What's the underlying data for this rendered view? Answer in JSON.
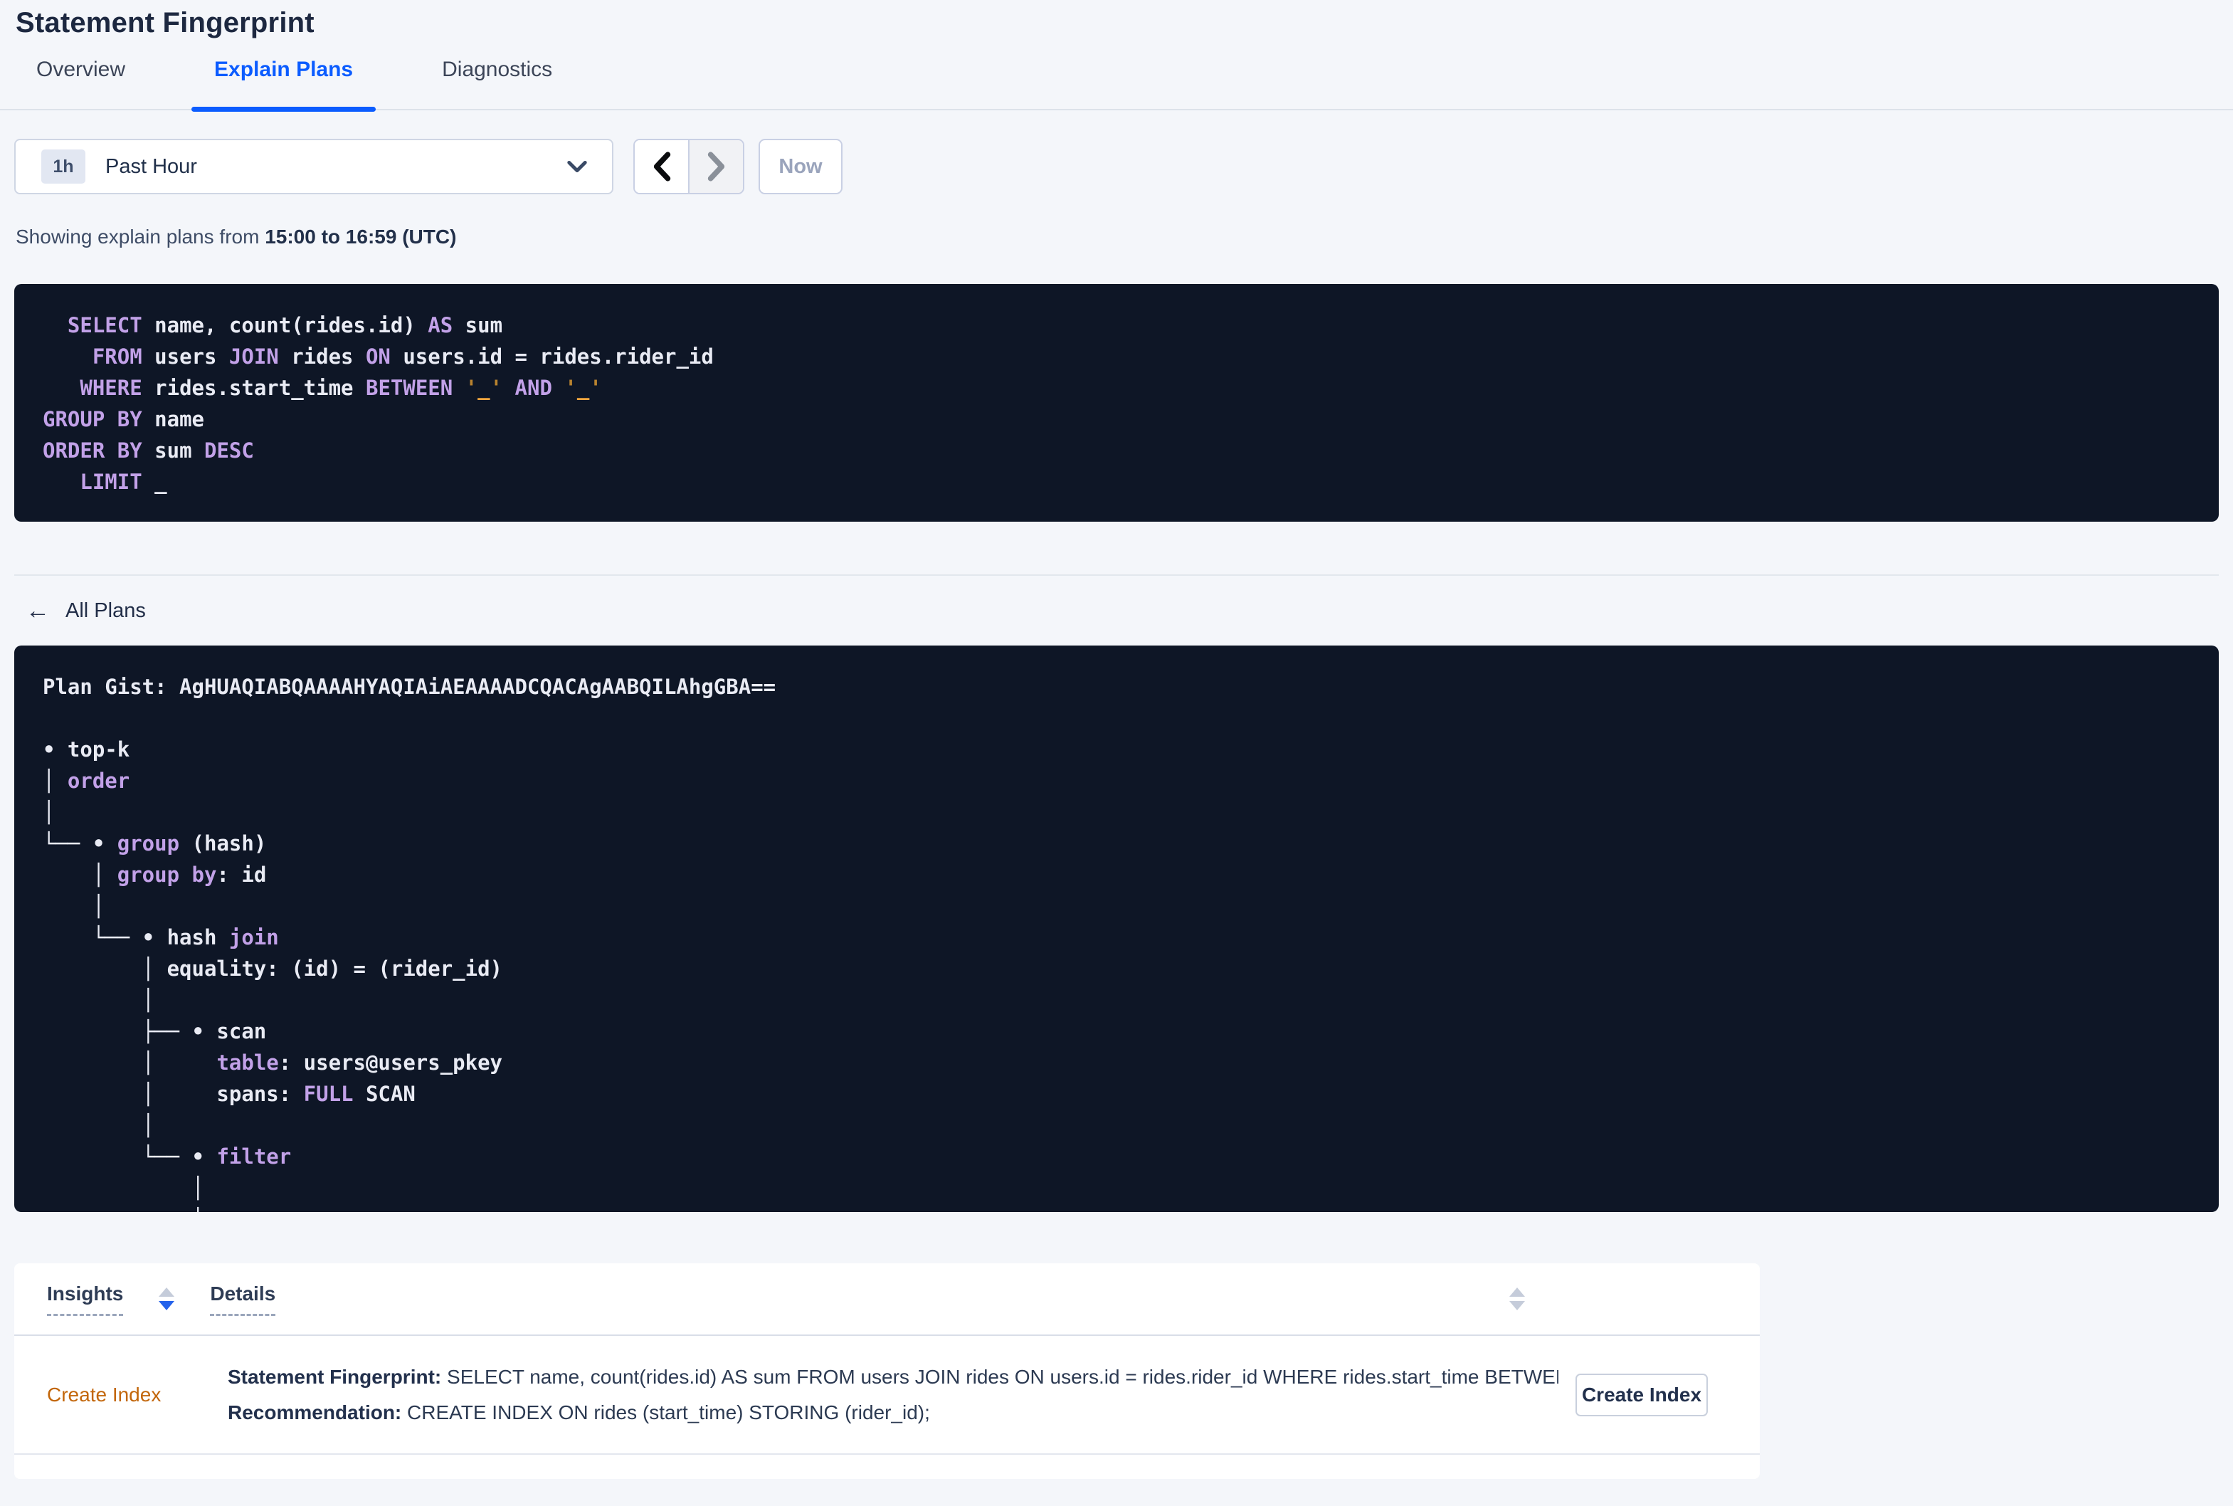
{
  "page": {
    "title": "Statement Fingerprint"
  },
  "tabs": [
    {
      "label": "Overview"
    },
    {
      "label": "Explain Plans"
    },
    {
      "label": "Diagnostics"
    }
  ],
  "toolbar": {
    "range_badge": "1h",
    "range_label": "Past Hour",
    "now_label": "Now"
  },
  "subtitle": {
    "prefix": "Showing explain plans from ",
    "bold": "15:00 to 16:59 (UTC)"
  },
  "back_link": {
    "label": "All Plans"
  },
  "colors": {
    "accent_blue": "#0B5CFF",
    "code_background": "#0E1626",
    "code_keyword": "#C2A1E8",
    "code_literal": "#F3A73F",
    "insight_orange": "#C2660A"
  },
  "sql": {
    "lines": [
      [
        [
          "t",
          "  "
        ],
        [
          "k",
          "SELECT"
        ],
        [
          "t",
          " name, count(rides.id) "
        ],
        [
          "k",
          "AS"
        ],
        [
          "t",
          " sum"
        ]
      ],
      [
        [
          "t",
          "    "
        ],
        [
          "k",
          "FROM"
        ],
        [
          "t",
          " users "
        ],
        [
          "k",
          "JOIN"
        ],
        [
          "t",
          " rides "
        ],
        [
          "k",
          "ON"
        ],
        [
          "t",
          " users.id = rides.rider_id"
        ]
      ],
      [
        [
          "t",
          "   "
        ],
        [
          "k",
          "WHERE"
        ],
        [
          "t",
          " rides.start_time "
        ],
        [
          "k",
          "BETWEEN"
        ],
        [
          "t",
          " "
        ],
        [
          "q",
          "'"
        ],
        [
          "l",
          "_"
        ],
        [
          "q",
          "'"
        ],
        [
          "t",
          " "
        ],
        [
          "k",
          "AND"
        ],
        [
          "t",
          " "
        ],
        [
          "q",
          "'"
        ],
        [
          "l",
          "_"
        ],
        [
          "q",
          "'"
        ]
      ],
      [
        [
          "k",
          "GROUP BY"
        ],
        [
          "t",
          " name"
        ]
      ],
      [
        [
          "k",
          "ORDER BY"
        ],
        [
          "t",
          " sum "
        ],
        [
          "k",
          "DESC"
        ]
      ],
      [
        [
          "t",
          "   "
        ],
        [
          "k",
          "LIMIT"
        ],
        [
          "t",
          " _"
        ]
      ]
    ]
  },
  "plan": {
    "lines": [
      [
        [
          "t",
          "Plan Gist: AgHUAQIABQAAAAHYAQIAiAEAAAADCQACAgAABQILAhgGBA=="
        ]
      ],
      [],
      [
        [
          "t",
          "• top-k"
        ]
      ],
      [
        [
          "t",
          "│ "
        ],
        [
          "k",
          "order"
        ]
      ],
      [
        [
          "t",
          "│"
        ]
      ],
      [
        [
          "t",
          "└── • "
        ],
        [
          "k",
          "group"
        ],
        [
          "t",
          " (hash)"
        ]
      ],
      [
        [
          "t",
          "    │ "
        ],
        [
          "k",
          "group by"
        ],
        [
          "t",
          ": id"
        ]
      ],
      [
        [
          "t",
          "    │"
        ]
      ],
      [
        [
          "t",
          "    └── • hash "
        ],
        [
          "k",
          "join"
        ]
      ],
      [
        [
          "t",
          "        │ equality: (id) = (rider_id)"
        ]
      ],
      [
        [
          "t",
          "        │"
        ]
      ],
      [
        [
          "t",
          "        ├── • scan"
        ]
      ],
      [
        [
          "t",
          "        │     "
        ],
        [
          "k",
          "table"
        ],
        [
          "t",
          ": users@users_pkey"
        ]
      ],
      [
        [
          "t",
          "        │     spans: "
        ],
        [
          "k",
          "FULL"
        ],
        [
          "t",
          " SCAN"
        ]
      ],
      [
        [
          "t",
          "        │"
        ]
      ],
      [
        [
          "t",
          "        └── • "
        ],
        [
          "k",
          "filter"
        ]
      ],
      [
        [
          "t",
          "            │"
        ]
      ],
      [
        [
          "t",
          "            │"
        ]
      ]
    ]
  },
  "table": {
    "headers": {
      "insights": "Insights",
      "details": "Details"
    },
    "row": {
      "insight_label": "Create Index",
      "line1_label": "Statement Fingerprint:",
      "line1_text": " SELECT name, count(rides.id) AS sum FROM users JOIN rides ON users.id = rides.rider_id WHERE rides.start_time BETWEEN '_…",
      "line2_label": "Recommendation:",
      "line2_text": " CREATE INDEX ON rides (start_time) STORING (rider_id);",
      "button_label": "Create Index"
    }
  }
}
